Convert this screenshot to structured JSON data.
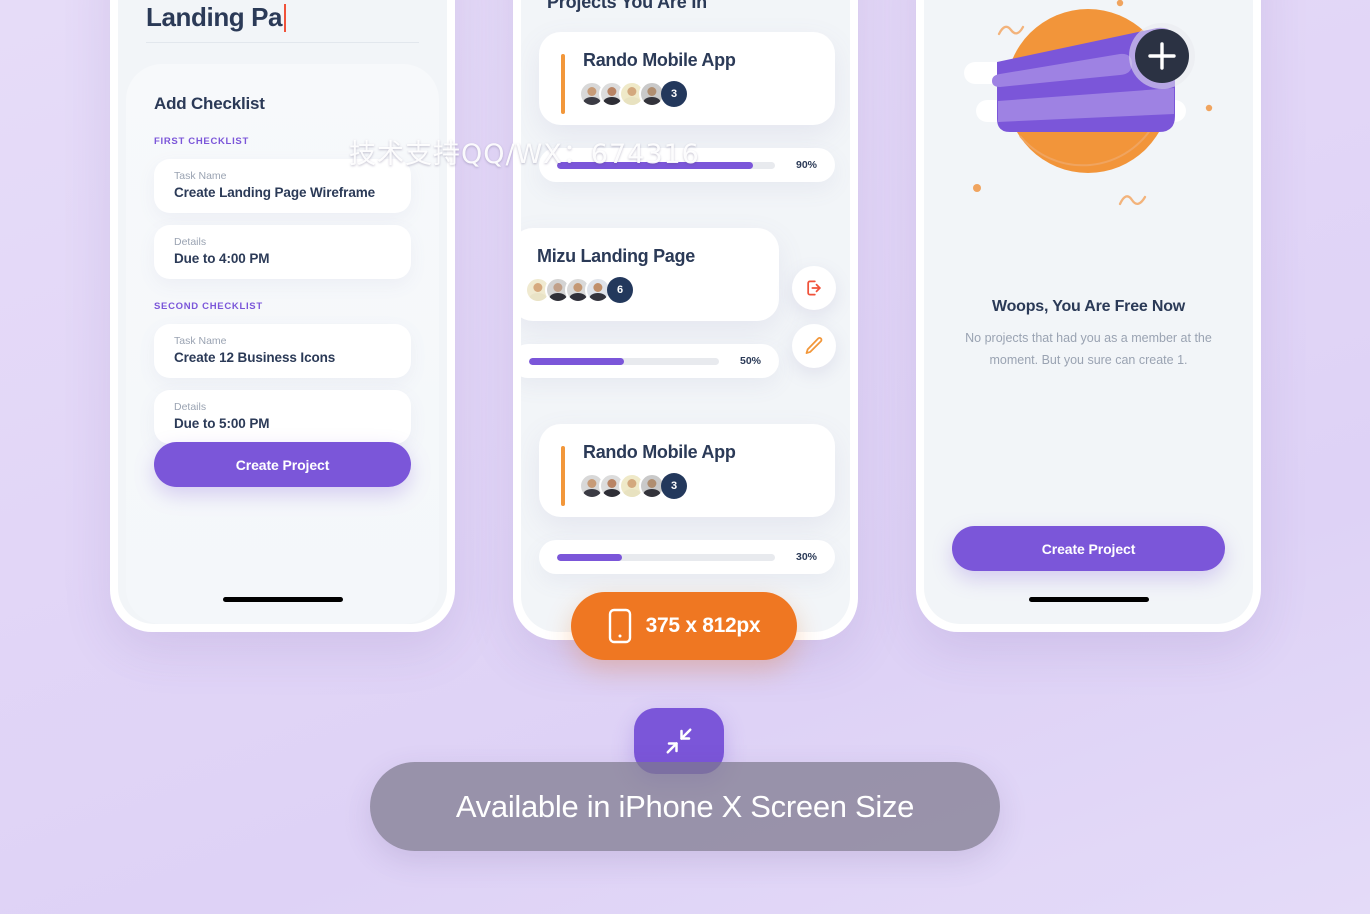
{
  "background": {
    "color": "#e2d6f7"
  },
  "theme": {
    "purple": "#7b56d9",
    "orange": "#f2973a",
    "badge_orange": "#ef7722",
    "navy": "#2b3a57",
    "red": "#f0523a",
    "muted": "#9aa3b2"
  },
  "left_phone": {
    "title": "Landing Pa",
    "checklist_heading": "Add Checklist",
    "sections": [
      {
        "label": "FIRST CHECKLIST",
        "fields": [
          {
            "label": "Task Name",
            "value": "Create Landing Page Wireframe"
          },
          {
            "label": "Details",
            "value": "Due to 4:00 PM"
          }
        ]
      },
      {
        "label": "SECOND CHECKLIST",
        "fields": [
          {
            "label": "Task Name",
            "value": "Create 12 Business Icons"
          },
          {
            "label": "Details",
            "value": "Due to 5:00 PM"
          }
        ]
      }
    ],
    "create_button": "Create Project"
  },
  "mid_phone": {
    "title": "Projects You Are In",
    "projects": [
      {
        "name": "Rando Mobile App",
        "member_overflow": "3",
        "progress_label": "90%",
        "progress": 90,
        "swiped": false
      },
      {
        "name": "Mizu Landing Page",
        "member_overflow": "6",
        "progress_label": "50%",
        "progress": 50,
        "swiped": true
      },
      {
        "name": "Rando Mobile App",
        "member_overflow": "3",
        "progress_label": "30%",
        "progress": 30,
        "swiped": false
      }
    ],
    "actions": [
      {
        "name": "leave-project",
        "icon": "exit-icon",
        "color": "#f0523a"
      },
      {
        "name": "edit-project",
        "icon": "pencil-icon",
        "color": "#f2973a"
      }
    ]
  },
  "right_phone": {
    "empty_title": "Woops, You Are Free Now",
    "empty_desc": "No projects that had you as a member at the moment. But you sure can create 1.",
    "create_button": "Create Project"
  },
  "badges": {
    "size_label": "375 x 812px",
    "size_icon": "mobile-phone-icon",
    "collapse_icon": "compress-arrows-icon",
    "availability_label": "Available in iPhone X Screen Size"
  },
  "watermark": {
    "text": "技术支持QQ/WX：674316"
  }
}
